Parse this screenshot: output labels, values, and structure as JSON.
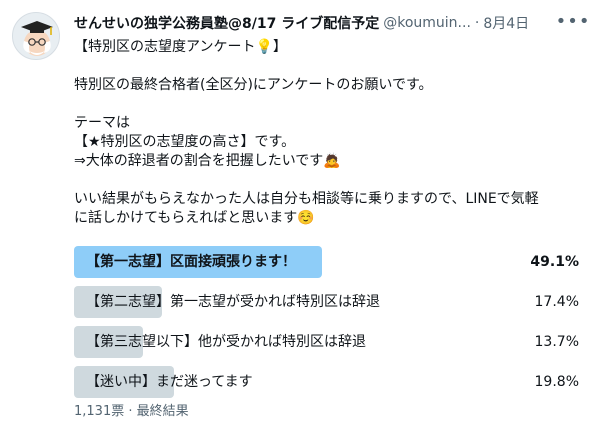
{
  "tweet": {
    "author_name": "せんせいの独学公務員塾@8/17 ライブ配信予定",
    "author_handle": "@koumuin...",
    "dot": "·",
    "date": "8月4日",
    "more_icon": "more-horizontal-icon",
    "avatar_icon": "professor-avatar",
    "lines": [
      "【特別区の志望度アンケート💡】",
      "",
      "特別区の最終合格者(全区分)にアンケートのお願いです。",
      "",
      "テーマは",
      "【★特別区の志望度の高さ】です。",
      "⇒大体の辞退者の割合を把握したいです🙇",
      "",
      "いい結果がもらえなかった人は自分も相談等に乗りますので、LINEで気軽",
      "に話しかけてもらえればと思います☺️"
    ]
  },
  "poll": {
    "options": [
      {
        "label": "【第一志望】区面接頑張ります！",
        "percent_text": "49.1%",
        "percent": 49.1,
        "winner": true
      },
      {
        "label": "【第二志望】第一志望が受かれば特別区は辞退",
        "percent_text": "17.4%",
        "percent": 17.4,
        "winner": false
      },
      {
        "label": "【第三志望以下】他が受かれば特別区は辞退",
        "percent_text": "13.7%",
        "percent": 13.7,
        "winner": false
      },
      {
        "label": "【迷い中】まだ迷ってます",
        "percent_text": "19.8%",
        "percent": 19.8,
        "winner": false
      }
    ],
    "winner_color": "#8ecdf8",
    "other_color": "#cfd9de"
  },
  "footer": {
    "votes": "1,131票",
    "dot": "·",
    "status": "最終結果"
  }
}
